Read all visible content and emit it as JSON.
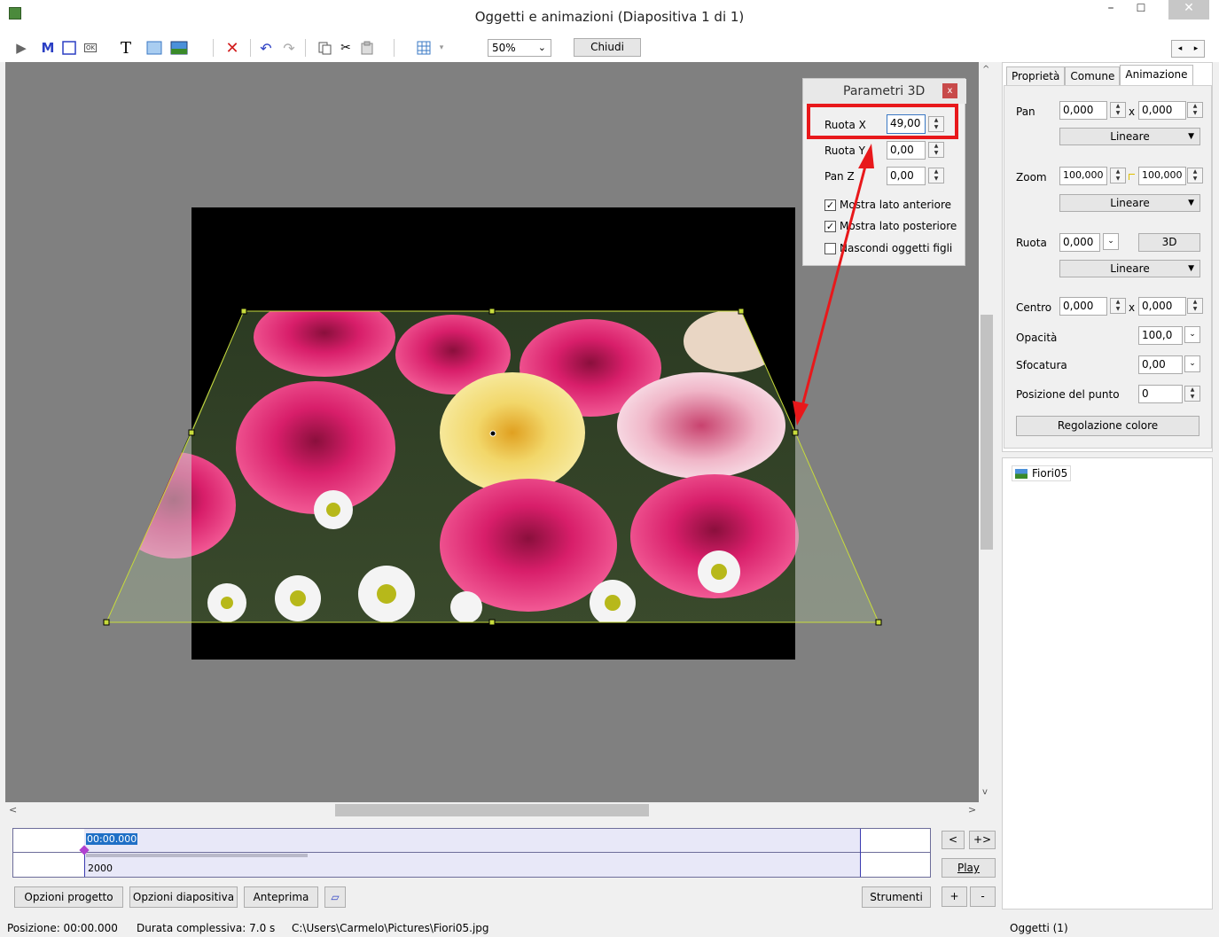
{
  "window": {
    "title": "Oggetti e animazioni  (Diapositiva 1 di 1)",
    "minimize_icon": "minimize-icon",
    "maximize_icon": "maximize-icon",
    "close_icon": "close-icon"
  },
  "toolbar": {
    "icons": [
      "camera-icon",
      "mask-icon",
      "frame-icon",
      "button-icon",
      "text-icon",
      "rectangle-icon",
      "image-icon",
      "delete-icon",
      "undo-icon",
      "redo-icon",
      "copy-icon",
      "cut-icon",
      "paste-icon",
      "grid-icon"
    ],
    "text_icon_label": "T",
    "mask_icon_label": "M",
    "ok_icon_label": "OK",
    "zoom_value": "50%",
    "close_label": "Chiudi"
  },
  "panel_3d": {
    "title": "Parametri 3D",
    "close_label": "x",
    "ruota_x_label": "Ruota X",
    "ruota_x_value": "49,00",
    "ruota_y_label": "Ruota Y",
    "ruota_y_value": "0,00",
    "pan_z_label": "Pan Z",
    "pan_z_value": "0,00",
    "show_front_label": "Mostra lato anteriore",
    "show_front_checked": true,
    "show_back_label": "Mostra lato posteriore",
    "show_back_checked": true,
    "hide_children_label": "Nascondi oggetti figli",
    "hide_children_checked": false
  },
  "tabs": [
    "Proprietà",
    "Comune",
    "Animazione"
  ],
  "active_tab": "Animazione",
  "animation": {
    "pan_label": "Pan",
    "pan_x": "0,000",
    "pan_y": "0,000",
    "pan_mode": "Lineare",
    "zoom_label": "Zoom",
    "zoom_x": "100,000",
    "zoom_y": "100,000",
    "zoom_mode": "Lineare",
    "ruota_label": "Ruota",
    "ruota_value": "0,000",
    "ruota_3d_label": "3D",
    "ruota_mode": "Lineare",
    "centro_label": "Centro",
    "centro_x": "0,000",
    "centro_y": "0,000",
    "x_sep": "x",
    "opacita_label": "Opacità",
    "opacita_value": "100,0",
    "sfocatura_label": "Sfocatura",
    "sfocatura_value": "0,00",
    "posizione_punto_label": "Posizione del punto",
    "posizione_punto_value": "0",
    "regolazione_colore_label": "Regolazione colore"
  },
  "objects": {
    "items": [
      "Fiori05"
    ],
    "count_label": "Oggetti (1)"
  },
  "timeline": {
    "time": "00:00.000",
    "value": "2000",
    "prev_label": "<",
    "next_label": "+>",
    "play_label": "Play",
    "add_label": "+",
    "remove_label": "-"
  },
  "bottom_buttons": {
    "project_options": "Opzioni progetto",
    "slide_options": "Opzioni diapositiva",
    "preview": "Anteprima",
    "tools": "Strumenti"
  },
  "status": {
    "position": "Posizione:  00:00.000",
    "duration": "Durata complessiva:  7.0 s",
    "path": "C:\\Users\\Carmelo\\Pictures\\Fiori05.jpg"
  },
  "colors": {
    "highlight": "#e8181b",
    "arrow": "#e8181b",
    "canvas": "#808080",
    "selection": "#c8dc3c"
  }
}
